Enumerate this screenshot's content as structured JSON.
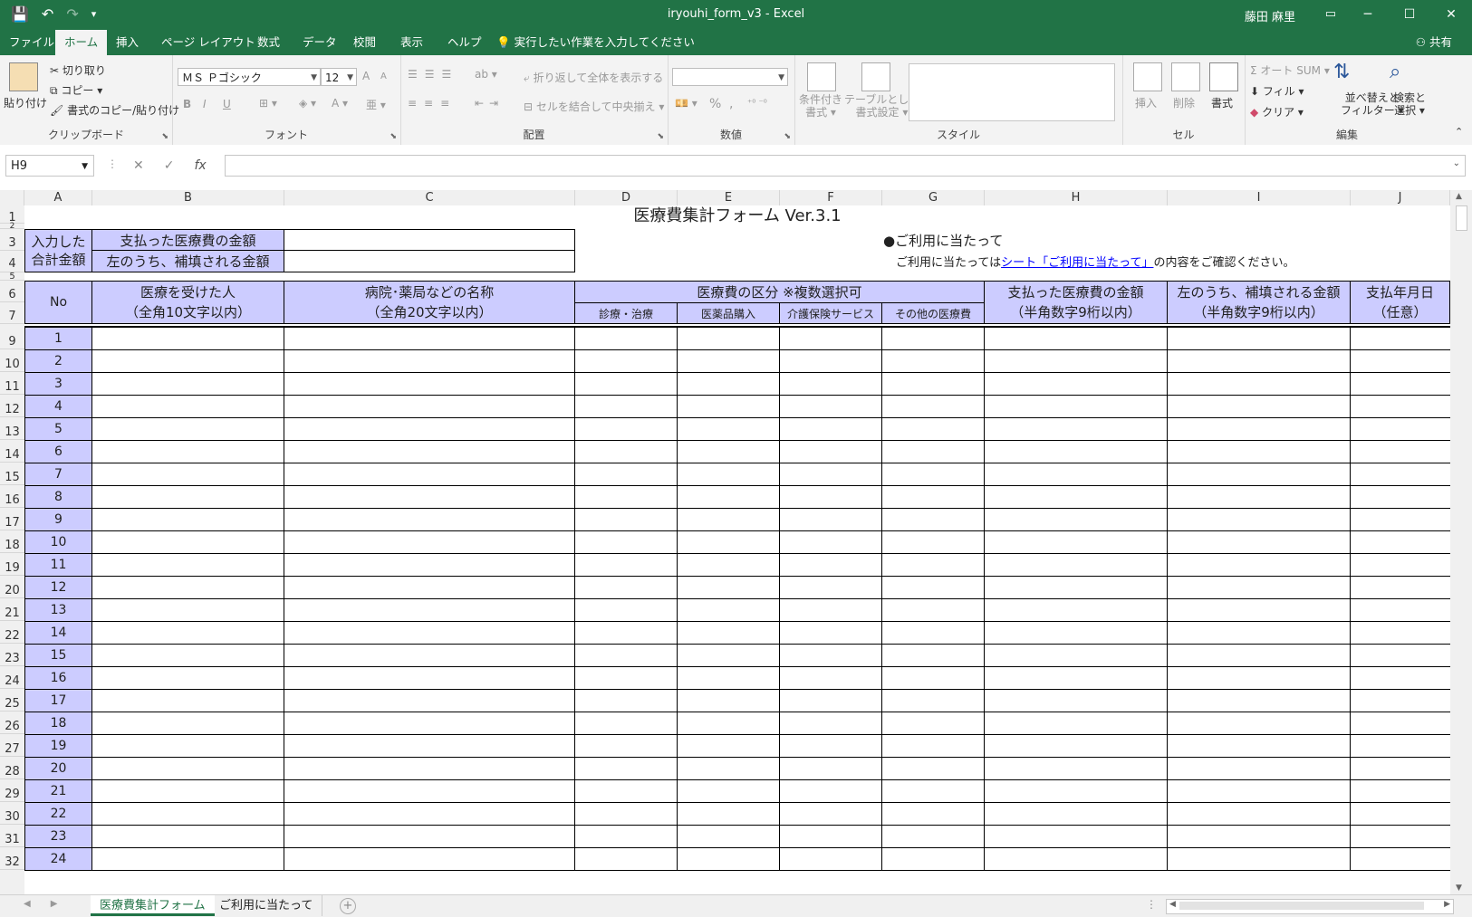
{
  "window": {
    "title": "iryouhi_form_v3  -  Excel",
    "user": "藤田 麻里",
    "controls": [
      "─",
      "☐",
      "✕"
    ],
    "ribbon_display_icon": "▭"
  },
  "qat": {
    "save_icon": "💾",
    "undo_icon": "↶",
    "redo_icon": "↷",
    "customize_icon": "▾"
  },
  "menu": {
    "tabs": [
      "ファイル",
      "ホーム",
      "挿入",
      "ページ レイアウト",
      "数式",
      "データ",
      "校閲",
      "表示",
      "ヘルプ"
    ],
    "active_tab": "ホーム",
    "tell_me": "実行したい作業を入力してください",
    "share": "共有"
  },
  "ribbon": {
    "clipboard": {
      "label": "クリップボード",
      "paste": "貼り付け",
      "cut": "切り取り",
      "copy": "コピー",
      "format_painter": "書式のコピー/貼り付け"
    },
    "font": {
      "label": "フォント",
      "name": "ＭＳ Ｐゴシック",
      "size": "12",
      "bold": "B",
      "italic": "I",
      "underline": "U",
      "grow": "A",
      "shrink": "A"
    },
    "alignment": {
      "label": "配置",
      "wrap": "折り返して全体を表示する",
      "merge": "セルを結合して中央揃え"
    },
    "number": {
      "label": "数値",
      "format": "",
      "percent": "%",
      "comma": ","
    },
    "styles": {
      "label": "スタイル",
      "conditional": [
        "条件付き",
        "書式"
      ],
      "table": [
        "テーブルとして",
        "書式設定"
      ]
    },
    "cells": {
      "label": "セル",
      "insert": "挿入",
      "delete": "削除",
      "format": "書式"
    },
    "editing": {
      "label": "編集",
      "autosum": "オート SUM",
      "fill": "フィル",
      "clear": "クリア",
      "sort": [
        "並べ替えと",
        "フィルター"
      ],
      "find": [
        "検索と",
        "選択"
      ]
    }
  },
  "formula_bar": {
    "name_box": "H9",
    "fx": "fx",
    "value": ""
  },
  "columns": [
    "A",
    "B",
    "C",
    "D",
    "E",
    "F",
    "G",
    "H",
    "I",
    "J"
  ],
  "row_numbers": [
    "1",
    "2",
    "3",
    "4",
    "5",
    "6",
    "7",
    "9",
    "10",
    "11",
    "12",
    "13",
    "14",
    "15",
    "16",
    "17",
    "18",
    "19",
    "20",
    "21",
    "22",
    "23",
    "24",
    "25",
    "26",
    "27",
    "28",
    "29",
    "30",
    "31",
    "32"
  ],
  "sheet": {
    "form_title": "医療費集計フォーム Ver.3.1",
    "summary": {
      "label_line1": "入力した",
      "label_line2": "合計金額",
      "paid_label": "支払った医療費の金額",
      "reimbursed_label": "左のうち、補填される金額"
    },
    "notice": {
      "heading": "●ご利用に当たって",
      "text_before": "ご利用に当たっては",
      "link": "シート「ご利用に当たって」",
      "text_after": "の内容をご確認ください。"
    },
    "headers": {
      "no": "No",
      "patient": [
        "医療を受けた人",
        "（全角10文字以内）"
      ],
      "provider": [
        "病院･薬局などの名称",
        "（全角20文字以内）"
      ],
      "category": "医療費の区分 ※複数選択可",
      "sub": [
        "診療・治療",
        "医薬品購入",
        "介護保険サービス",
        "その他の医療費"
      ],
      "paid": [
        "支払った医療費の金額",
        "（半角数字9桁以内）"
      ],
      "reimbursed": [
        "左のうち、補填される金額",
        "（半角数字9桁以内）"
      ],
      "date": [
        "支払年月日",
        "（任意）"
      ]
    },
    "row_nos": [
      "1",
      "2",
      "3",
      "4",
      "5",
      "6",
      "7",
      "8",
      "9",
      "10",
      "11",
      "12",
      "13",
      "14",
      "15",
      "16",
      "17",
      "18",
      "19",
      "20",
      "21",
      "22",
      "23",
      "24"
    ]
  },
  "sheet_tabs": [
    "医療費集計フォーム",
    "ご利用に当たって"
  ],
  "active_sheet": "医療費集計フォーム"
}
